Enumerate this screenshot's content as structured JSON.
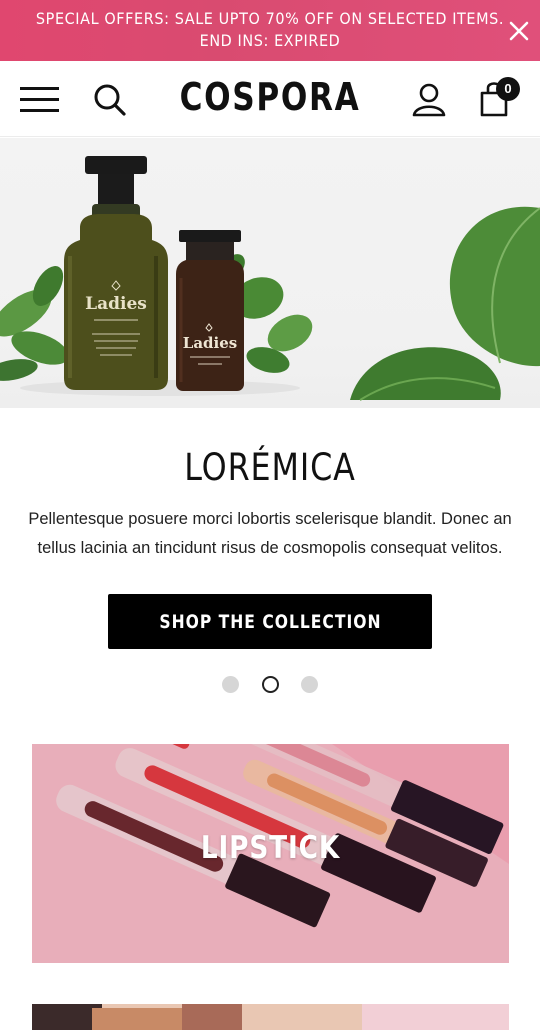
{
  "announcement": {
    "line1": "SPECIAL OFFERS: SALE UPTO 70% OFF ON SELECTED ITEMS.",
    "line2": "END INS:   EXPIRED",
    "close_icon": "close-icon"
  },
  "header": {
    "logo": "COSPORA",
    "menu_icon": "hamburger-menu-icon",
    "search_icon": "search-icon",
    "account_icon": "user-icon",
    "cart_icon": "shopping-bag-icon",
    "cart_count": "0"
  },
  "hero": {
    "bottle_large_label": "Ladies",
    "bottle_small_label": "Ladies",
    "title": "LORÉMICA",
    "text": "Pellentesque posuere morci lobortis scelerisque blandit. Donec an tellus lacinia an tincidunt risus de cosmopolis consequat velitos.",
    "button_label": "SHOP THE COLLECTION",
    "slides": 3,
    "active_slide": 2
  },
  "categories": [
    {
      "label": "LIPSTICK"
    },
    {
      "label": ""
    }
  ],
  "colors": {
    "announcement_bg": "#dc4a72",
    "button_bg": "#000000",
    "lipstick_bg": "#f4b6c2"
  }
}
